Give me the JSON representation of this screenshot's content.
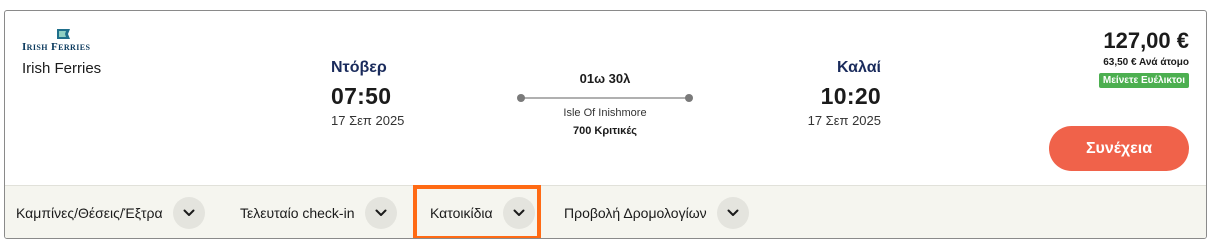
{
  "operator": {
    "logo_text": "Irish Ferries",
    "name": "Irish Ferries"
  },
  "departure": {
    "city": "Ντόβερ",
    "time": "07:50",
    "date": "17 Σεπ 2025"
  },
  "route": {
    "duration": "01ω 30λ",
    "vessel": "Isle Of Inishmore",
    "reviews": "700 Κριτικές"
  },
  "arrival": {
    "city": "Καλαί",
    "time": "10:20",
    "date": "17 Σεπ 2025"
  },
  "price": {
    "total": "127,00 €",
    "per_person": "63,50 € Ανά άτομο",
    "badge": "Μείνετε Ευέλικτοι"
  },
  "actions": {
    "continue_label": "Συνέχεια"
  },
  "tabs": [
    {
      "label": "Καμπίνες/Θέσεις/Έξτρα",
      "icon": "chevron-down-icon"
    },
    {
      "label": "Τελευταίο check-in",
      "icon": "chevron-down-icon"
    },
    {
      "label": "Κατοικίδια",
      "icon": "chevron-down-icon"
    },
    {
      "label": "Προβολή Δρομολογίων",
      "icon": "chevron-down-icon"
    }
  ],
  "colors": {
    "accent_button": "#f0624a",
    "badge": "#4caf50",
    "highlight": "#ff6a14",
    "city_text": "#1a2b5c",
    "bottom_bar": "#f5f5ef"
  }
}
